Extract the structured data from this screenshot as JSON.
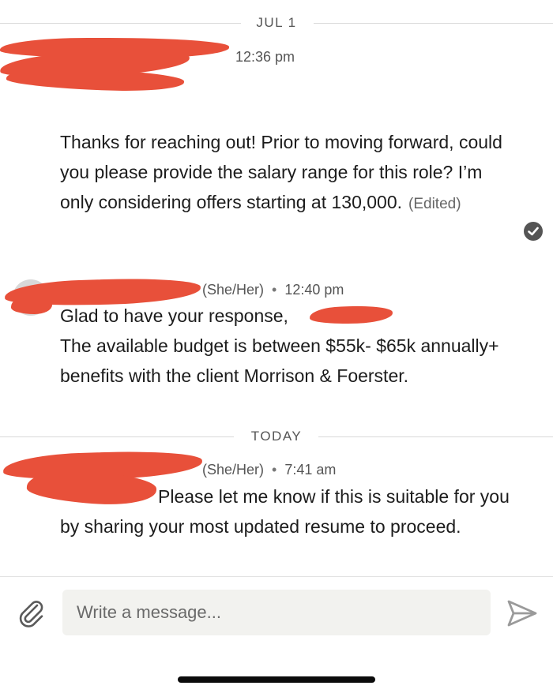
{
  "dividers": {
    "first": "JUL 1",
    "second": "TODAY"
  },
  "messages": [
    {
      "sender_pronouns": "",
      "time": "12:36 pm",
      "text": "Thanks for reaching out! Prior to moving forward, could you please provide the salary range for this role? I’m only considering offers starting at 130,000.",
      "edited_label": "(Edited)"
    },
    {
      "sender_pronouns": "(She/Her)",
      "time": "12:40 pm",
      "line1": "Glad to have your response,",
      "line2": "The available budget is between $55k- $65k annually+ benefits with the client Morrison & Foerster."
    },
    {
      "sender_pronouns": "(She/Her)",
      "time": "7:41 am",
      "text": "Please let me know if this is suitable for you by sharing your most updated resume to proceed."
    }
  ],
  "composer": {
    "placeholder": "Write a message..."
  },
  "icons": {
    "attach": "paperclip-icon",
    "send": "send-icon",
    "read_receipt": "check-circle-icon"
  },
  "colors": {
    "redaction": "#e8503a",
    "divider_line": "#d9d9d9",
    "input_bg": "#f2f2ef"
  }
}
